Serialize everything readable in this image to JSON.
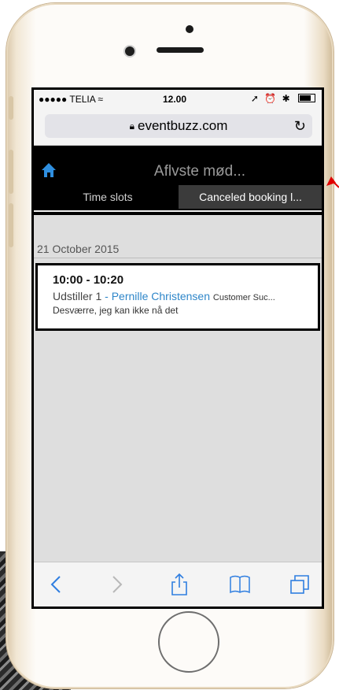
{
  "status_bar": {
    "carrier": "●●●●● TELIA",
    "time": "12.00",
    "right_icons": "➚ ⏰ ✱ ▮"
  },
  "browser": {
    "url": "eventbuzz.com"
  },
  "header": {
    "title": "Aflvste mød..."
  },
  "tabs": [
    {
      "label": "Time slots",
      "active": false
    },
    {
      "label": "Canceled booking l...",
      "active": true
    }
  ],
  "day": {
    "date": "21 October 2015"
  },
  "booking": {
    "time": "10:00 - 10:20",
    "exhibitor": "Udstiller 1",
    "separator": " - ",
    "contact": "Pernille Christensen",
    "role": "Customer Suc...",
    "note": "Desværre, jeg kan ikke nå det"
  },
  "colors": {
    "accent": "#2e86c9",
    "header_bg": "#000000",
    "annotation_arrow": "#e00000"
  },
  "icons": {
    "home": "home-icon",
    "lock": "lock-icon",
    "reload": "reload-icon",
    "back": "back-icon",
    "forward": "forward-icon",
    "share": "share-icon",
    "bookmarks": "bookmarks-icon",
    "tabs": "tabs-icon"
  }
}
